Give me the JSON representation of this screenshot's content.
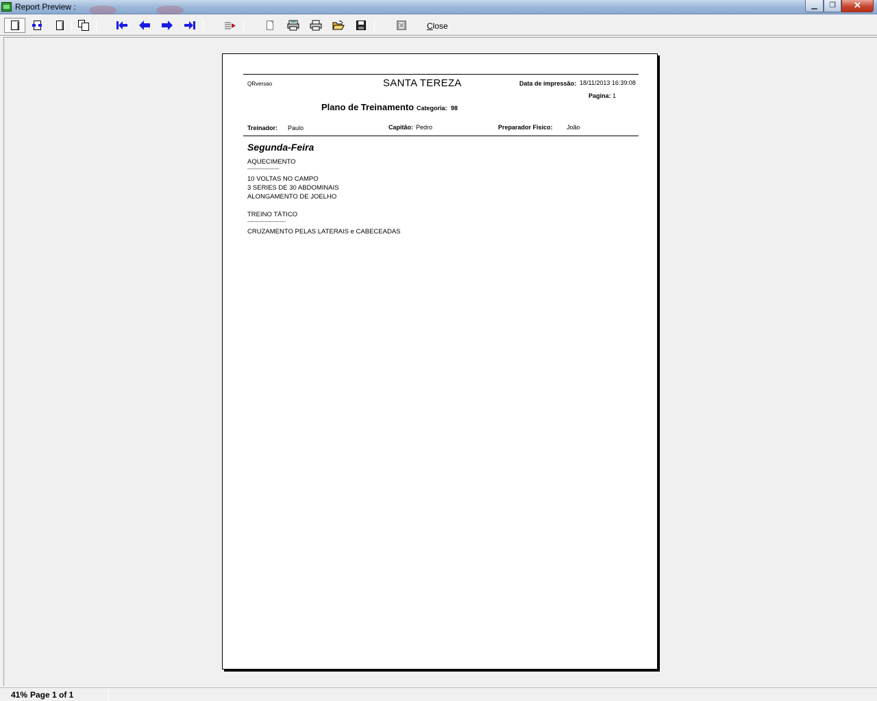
{
  "window": {
    "title": "Report Preview :",
    "buttons": {
      "minimize": "▁",
      "maximize": "❐",
      "close": "✕"
    }
  },
  "toolbar": {
    "buttons": [
      {
        "id": "zoom-to-fit",
        "icon": "whole-page-icon"
      },
      {
        "id": "zoom-100",
        "icon": "actual-size-icon"
      },
      {
        "id": "zoom-to-width",
        "icon": "page-width-icon"
      },
      {
        "id": "two-pages",
        "icon": "multiple-pages-icon"
      },
      {
        "id": "first-page",
        "icon": "first-page-icon"
      },
      {
        "id": "previous-page",
        "icon": "previous-page-icon"
      },
      {
        "id": "next-page",
        "icon": "next-page-icon"
      },
      {
        "id": "last-page",
        "icon": "last-page-icon"
      },
      {
        "id": "goto-page",
        "icon": "goto-page-icon"
      },
      {
        "id": "print-setup",
        "icon": "print-setup-icon"
      },
      {
        "id": "printer-settings",
        "icon": "printer-icon"
      },
      {
        "id": "print",
        "icon": "print-icon"
      },
      {
        "id": "open",
        "icon": "open-folder-icon"
      },
      {
        "id": "save",
        "icon": "save-icon"
      },
      {
        "id": "export",
        "icon": "export-icon"
      }
    ],
    "close_label": "Close",
    "colors": {
      "nav_arrows": "#1a1ae6",
      "goto_arrow": "#c01818",
      "folder": "#e8b830"
    }
  },
  "report": {
    "version_label": "QRversao",
    "company": "SANTA TEREZA",
    "print_date_label": "Data de impressão:",
    "print_date_value": "18/11/2013 16:39:08",
    "page_label": "Pagina:",
    "page_value": "1",
    "plan_title": "Plano de Treinamento",
    "category_label": "Categoria:",
    "category_value": "98",
    "coach_label": "Treinador:",
    "coach_value": "Paulo",
    "captain_label": "Capitão:",
    "captain_value": "Pedro",
    "trainer_label": "Preparador Fisico:",
    "trainer_value": "João",
    "day": "Segunda-Feira",
    "lines": [
      "AQUECIMENTO",
      "--------------------",
      "10 VOLTAS NO CAMPO",
      "3 SERIES DE 30 ABDOMINAIS",
      "ALONGAMENTO DE JOELHO",
      "",
      "TREINO TÁTICO",
      "------------------------",
      "CRUZAMENTO PELAS LATERAIS e CABECEADAS"
    ]
  },
  "status": {
    "zoom": "41%",
    "page_info": "Page 1 of 1"
  }
}
